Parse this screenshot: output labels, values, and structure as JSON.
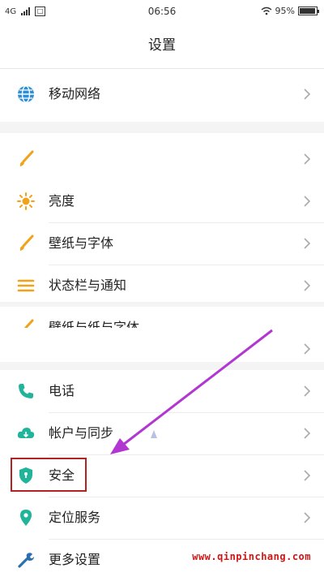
{
  "status": {
    "network": "4G",
    "time": "06:56",
    "battery": "95%",
    "battery_level": 0.95
  },
  "header": {
    "title": "设置"
  },
  "settings": [
    {
      "label": "移动网络",
      "icon": "globe-icon"
    },
    {
      "label": "",
      "icon": "brush-icon"
    },
    {
      "label": "亮度",
      "icon": "sun-icon"
    },
    {
      "label": "壁纸与字体",
      "icon": "brush-icon"
    },
    {
      "label": "状态栏与通知",
      "icon": "list-icon"
    },
    {
      "label": "壁纸与纸与字体",
      "icon": "brush-icon"
    },
    {
      "label": "",
      "icon": ""
    },
    {
      "label": "电话",
      "icon": "phone-icon"
    },
    {
      "label": "帐户与同步",
      "icon": "cloud-sync-icon"
    },
    {
      "label": "安全",
      "icon": "shield-icon"
    },
    {
      "label": "定位服务",
      "icon": "location-pin-icon"
    },
    {
      "label": "更多设置",
      "icon": "wrench-icon"
    }
  ],
  "annotation": {
    "arrow_color": "#b236d1",
    "highlight_color": "#b22222"
  },
  "watermark": "www.qinpinchang.com",
  "colors": {
    "accent_orange": "#f0a31a",
    "accent_teal": "#20b59a",
    "accent_blue": "#2a8fd8"
  }
}
